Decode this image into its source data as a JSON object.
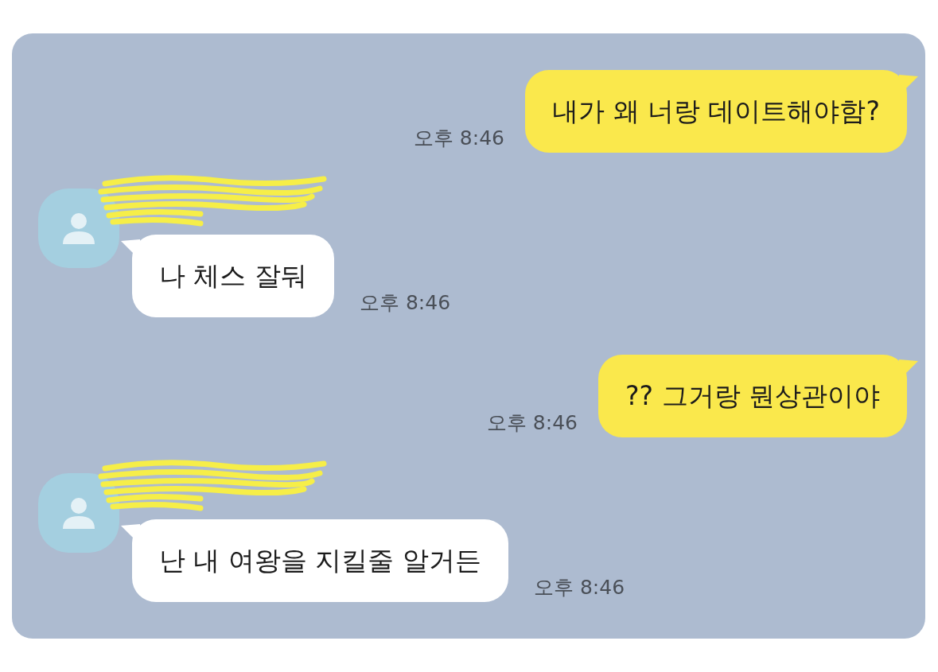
{
  "messages": [
    {
      "kind": "sent",
      "text": "내가 왜 너랑 데이트해야함?",
      "time": "오후 8:46"
    },
    {
      "kind": "received",
      "sender_redacted": true,
      "text": "나 체스 잘둬",
      "time": "오후 8:46"
    },
    {
      "kind": "sent",
      "text": "?? 그거랑 뭔상관이야",
      "time": "오후 8:46"
    },
    {
      "kind": "received",
      "sender_redacted": true,
      "text": "난 내 여왕을 지킬줄 알거든",
      "time": "오후 8:46"
    }
  ]
}
